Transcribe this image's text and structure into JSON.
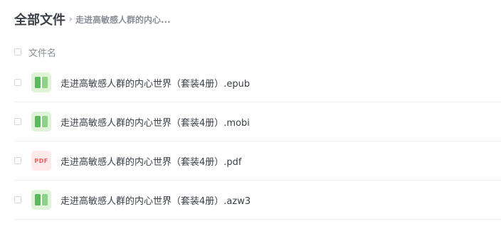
{
  "breadcrumb": {
    "root": "全部文件",
    "current": "走进高敏感人群的内心..."
  },
  "list_header": {
    "name_column": "文件名"
  },
  "files": [
    {
      "name": "走进高敏感人群的内心世界（套装4册）.epub",
      "icon": "book-icon",
      "icon_color": "#5cb85c"
    },
    {
      "name": "走进高敏感人群的内心世界（套装4册）.mobi",
      "icon": "book-icon",
      "icon_color": "#5cb85c"
    },
    {
      "name": "走进高敏感人群的内心世界（套装4册）.pdf",
      "icon": "pdf-icon",
      "icon_color": "#f15b5b",
      "icon_label": "PDF"
    },
    {
      "name": "走进高敏感人群的内心世界（套装4册）.azw3",
      "icon": "book-icon",
      "icon_color": "#5cb85c"
    }
  ]
}
